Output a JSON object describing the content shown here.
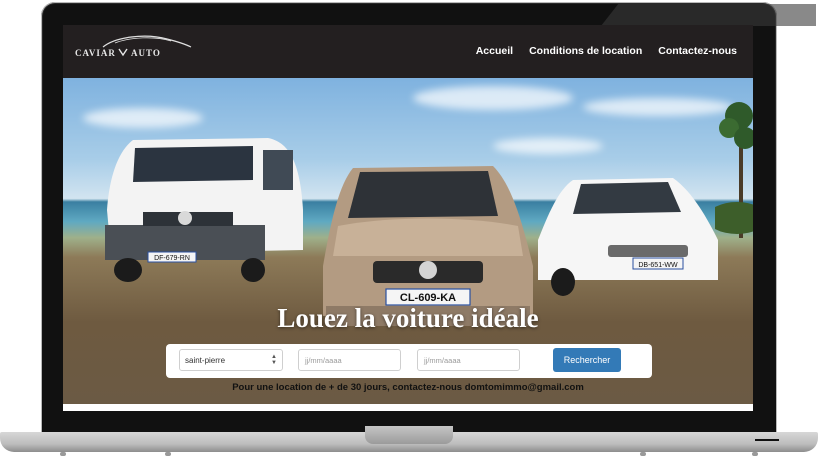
{
  "brand": {
    "name_left": "CAVIAR",
    "name_right": "AUTO"
  },
  "nav": {
    "items": [
      {
        "label": "Accueil"
      },
      {
        "label": "Conditions de location"
      },
      {
        "label": "Contactez-nous"
      }
    ]
  },
  "hero": {
    "title": "Louez la voiture idéale",
    "plates": [
      "DF-679-RN",
      "CL-609-KA",
      "DB-651-WW"
    ]
  },
  "search": {
    "location_value": "saint-pierre",
    "date_from_placeholder": "jj/mm/aaaa",
    "date_to_placeholder": "jj/mm/aaaa",
    "submit_label": "Rechercher"
  },
  "note": "Pour une location de + de 30 jours, contactez-nous domtomimmo@gmail.com",
  "colors": {
    "navbar": "#231f20",
    "button": "#337ab7"
  }
}
